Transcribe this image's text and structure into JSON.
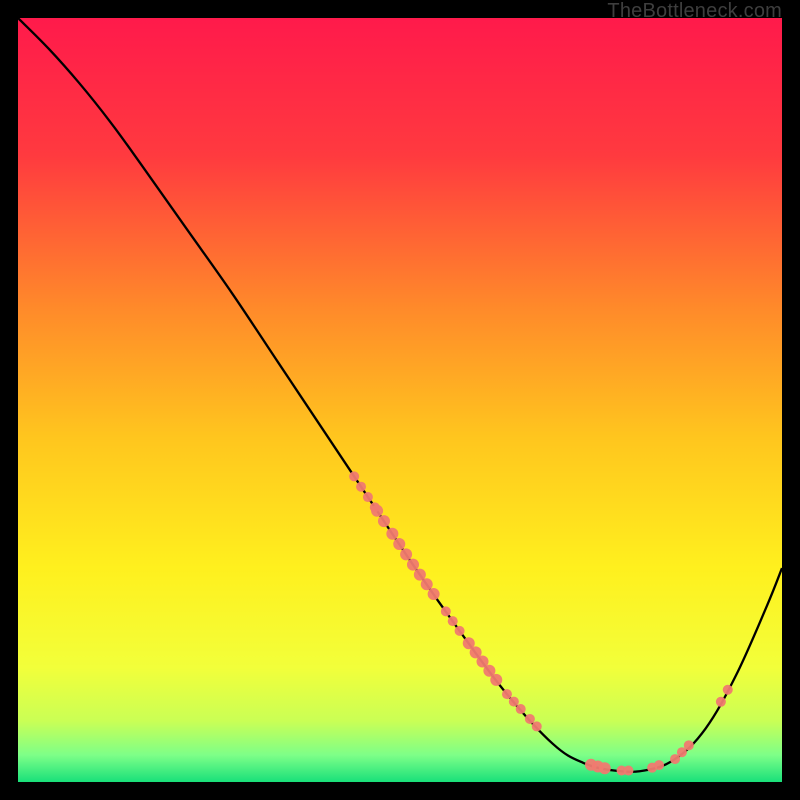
{
  "watermark": "TheBottleneck.com",
  "chart_data": {
    "type": "line",
    "title": "",
    "xlabel": "",
    "ylabel": "",
    "xlim": [
      0,
      100
    ],
    "ylim": [
      0,
      100
    ],
    "background_gradient": {
      "stops": [
        {
          "offset": 0.0,
          "color": "#ff1a4b"
        },
        {
          "offset": 0.18,
          "color": "#ff3a3f"
        },
        {
          "offset": 0.38,
          "color": "#ff8a2a"
        },
        {
          "offset": 0.55,
          "color": "#ffc61e"
        },
        {
          "offset": 0.72,
          "color": "#fff01e"
        },
        {
          "offset": 0.85,
          "color": "#f2ff3a"
        },
        {
          "offset": 0.92,
          "color": "#caff55"
        },
        {
          "offset": 0.965,
          "color": "#7dff88"
        },
        {
          "offset": 1.0,
          "color": "#19e07a"
        }
      ]
    },
    "curve": [
      {
        "x": 0.0,
        "y": 100.0
      },
      {
        "x": 4.0,
        "y": 96.0
      },
      {
        "x": 8.0,
        "y": 91.5
      },
      {
        "x": 12.0,
        "y": 86.5
      },
      {
        "x": 16.0,
        "y": 81.0
      },
      {
        "x": 22.0,
        "y": 72.5
      },
      {
        "x": 28.0,
        "y": 64.0
      },
      {
        "x": 34.0,
        "y": 55.0
      },
      {
        "x": 40.0,
        "y": 46.0
      },
      {
        "x": 46.0,
        "y": 37.0
      },
      {
        "x": 52.0,
        "y": 28.0
      },
      {
        "x": 58.0,
        "y": 19.5
      },
      {
        "x": 64.0,
        "y": 11.5
      },
      {
        "x": 70.0,
        "y": 5.0
      },
      {
        "x": 74.0,
        "y": 2.5
      },
      {
        "x": 78.0,
        "y": 1.5
      },
      {
        "x": 82.0,
        "y": 1.5
      },
      {
        "x": 86.0,
        "y": 3.0
      },
      {
        "x": 90.0,
        "y": 7.0
      },
      {
        "x": 94.0,
        "y": 14.0
      },
      {
        "x": 98.0,
        "y": 23.0
      },
      {
        "x": 100.0,
        "y": 28.0
      }
    ],
    "marker_clusters": [
      {
        "x_start": 44,
        "x_end": 47,
        "r": 5
      },
      {
        "x_start": 47,
        "x_end": 48,
        "r": 6
      },
      {
        "x_start": 49,
        "x_end": 55,
        "r": 6
      },
      {
        "x_start": 56,
        "x_end": 58,
        "r": 5
      },
      {
        "x_start": 59,
        "x_end": 63,
        "r": 6
      },
      {
        "x_start": 64,
        "x_end": 66,
        "r": 5
      },
      {
        "x_start": 67,
        "x_end": 68,
        "r": 5
      },
      {
        "x_start": 75,
        "x_end": 77,
        "r": 6
      },
      {
        "x_start": 79,
        "x_end": 80,
        "r": 5
      },
      {
        "x_start": 83,
        "x_end": 84,
        "r": 5
      },
      {
        "x_start": 86,
        "x_end": 88,
        "r": 5
      },
      {
        "x_start": 92,
        "x_end": 93,
        "r": 5
      }
    ],
    "marker_color": "#f07a70",
    "line_color": "#000000"
  }
}
